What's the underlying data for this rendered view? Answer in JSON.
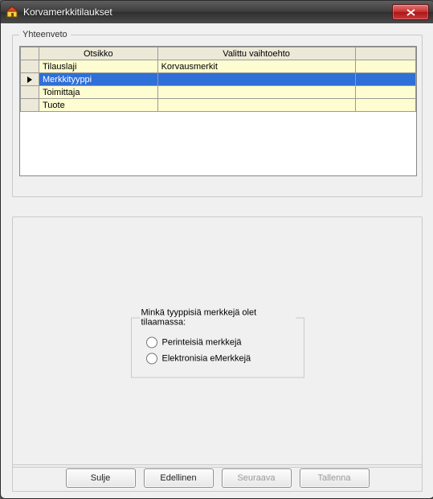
{
  "window": {
    "title": "Korvamerkkitilaukset"
  },
  "summary": {
    "legend": "Yhteenveto",
    "headers": {
      "col1": "Otsikko",
      "col2": "Valittu vaihtoehto"
    },
    "rows": [
      {
        "label": "Tilauslaji",
        "value": "Korvausmerkit",
        "selected": false
      },
      {
        "label": "Merkkityyppi",
        "value": "",
        "selected": true
      },
      {
        "label": "Toimittaja",
        "value": "",
        "selected": false
      },
      {
        "label": "Tuote",
        "value": "",
        "selected": false
      }
    ]
  },
  "radio": {
    "legend": "Minkä tyyppisiä merkkejä olet tilaamassa:",
    "options": [
      {
        "label": "Perinteisiä merkkejä"
      },
      {
        "label": "Elektronisia eMerkkejä"
      }
    ]
  },
  "buttons": {
    "close": {
      "label": "Sulje",
      "enabled": true
    },
    "previous": {
      "label": "Edellinen",
      "enabled": true
    },
    "next": {
      "label": "Seuraava",
      "enabled": false
    },
    "save": {
      "label": "Tallenna",
      "enabled": false
    }
  },
  "icons": {
    "app": "house-icon",
    "close": "close-icon",
    "row_indicator": "right-arrow-icon"
  }
}
